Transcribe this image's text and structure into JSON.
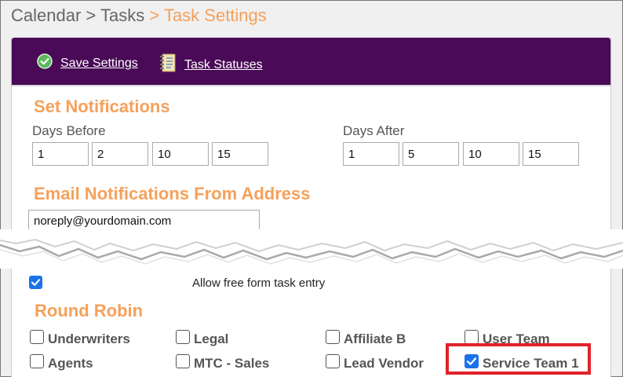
{
  "breadcrumb": {
    "calendar": "Calendar",
    "separator": ">",
    "tasks": "Tasks",
    "current": "Task Settings"
  },
  "toolbar": {
    "save_label": "Save Settings",
    "statuses_label": "Task Statuses"
  },
  "notifications": {
    "title": "Set Notifications",
    "days_before_label": "Days Before",
    "days_before": [
      "1",
      "2",
      "10",
      "15"
    ],
    "days_after_label": "Days After",
    "days_after": [
      "1",
      "5",
      "10",
      "15"
    ]
  },
  "email": {
    "title": "Email Notifications From Address",
    "value": "noreply@yourdomain.com"
  },
  "free_form": {
    "label": "Allow free form task entry",
    "checked": true
  },
  "round_robin": {
    "title": "Round Robin",
    "options": [
      {
        "label": "Underwriters",
        "checked": false
      },
      {
        "label": "Legal",
        "checked": false
      },
      {
        "label": "Affiliate B",
        "checked": false
      },
      {
        "label": "User Team",
        "checked": false
      },
      {
        "label": "Agents",
        "checked": false
      },
      {
        "label": "MTC - Sales",
        "checked": false
      },
      {
        "label": "Lead Vendor",
        "checked": false
      },
      {
        "label": "Service Team 1",
        "checked": true
      }
    ]
  },
  "colors": {
    "accent": "#f5a15a",
    "toolbar_bg": "#4a0a57",
    "highlight": "#e0222a",
    "checkbox_checked": "#1a73e8"
  }
}
